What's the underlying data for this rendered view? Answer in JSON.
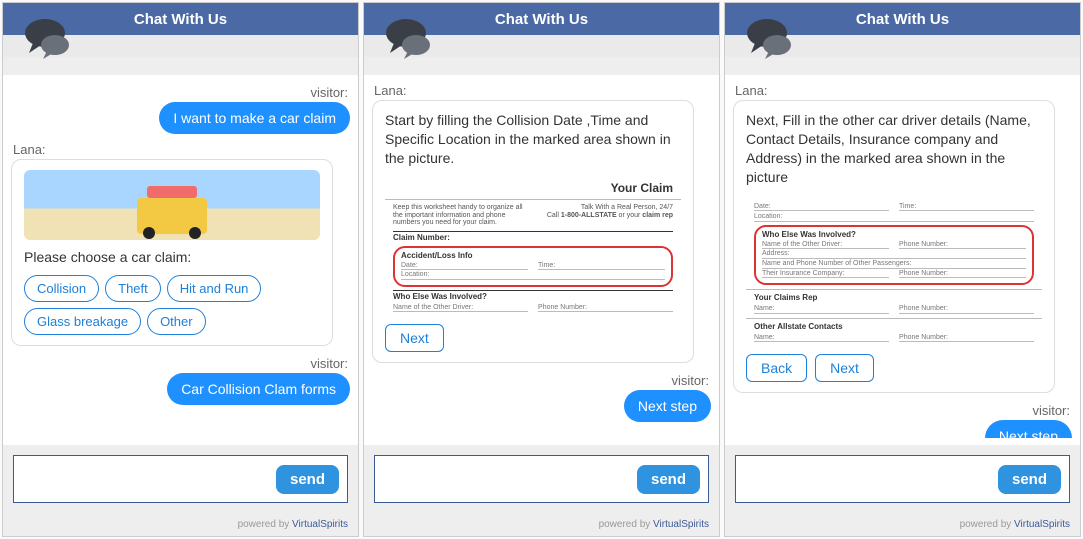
{
  "common": {
    "header": "Chat With Us",
    "send": "send",
    "powered": "powered  by",
    "brand": "VirtualSpirits",
    "visitor_label": "visitor:",
    "bot_name": "Lana:"
  },
  "p1": {
    "u1": "I want to make a car claim",
    "prompt": "Please choose a car claim:",
    "chips": [
      "Collision",
      "Theft",
      "Hit and Run",
      "Glass breakage",
      "Other"
    ],
    "u2": "Car Collision Clam forms"
  },
  "p2": {
    "msg": "Start by filling the Collision Date ,Time and Specific Location in the marked area shown in the picture.",
    "next_btn": "Next",
    "u1": "Next step",
    "form": {
      "title": "Your Claim",
      "left_tiny": "Keep this worksheet handy to organize all the important information and phone numbers you need for your claim.",
      "right1": "Talk With a Real Person, 24/7",
      "right2a": "Call ",
      "right2b": "1-800-ALLSTATE",
      "right2c": " or your ",
      "right2d": "claim rep",
      "claim_num": "Claim Number:",
      "sec1": "Accident/Loss Info",
      "date": "Date:",
      "time": "Time:",
      "location": "Location:",
      "sec2": "Who Else Was Involved?",
      "name_other": "Name of the Other Driver:",
      "phone": "Phone Number:"
    }
  },
  "p3": {
    "msg": "Next, Fill in the other car driver details (Name, Contact Details, Insurance company and Address) in the marked area shown in the picture",
    "back_btn": "Back",
    "next_btn": "Next",
    "u1_partial": "Next step",
    "form": {
      "date": "Date:",
      "time": "Time:",
      "location": "Location:",
      "sec2": "Who Else Was Involved?",
      "name_other": "Name of the Other Driver:",
      "address": "Address:",
      "passengers": "Name and Phone Number of Other Passengers:",
      "ins_co": "Their Insurance Company:",
      "phone": "Phone Number:",
      "sec_rep": "Your Claims Rep",
      "name": "Name:",
      "sec_contacts": "Other Allstate Contacts"
    }
  }
}
